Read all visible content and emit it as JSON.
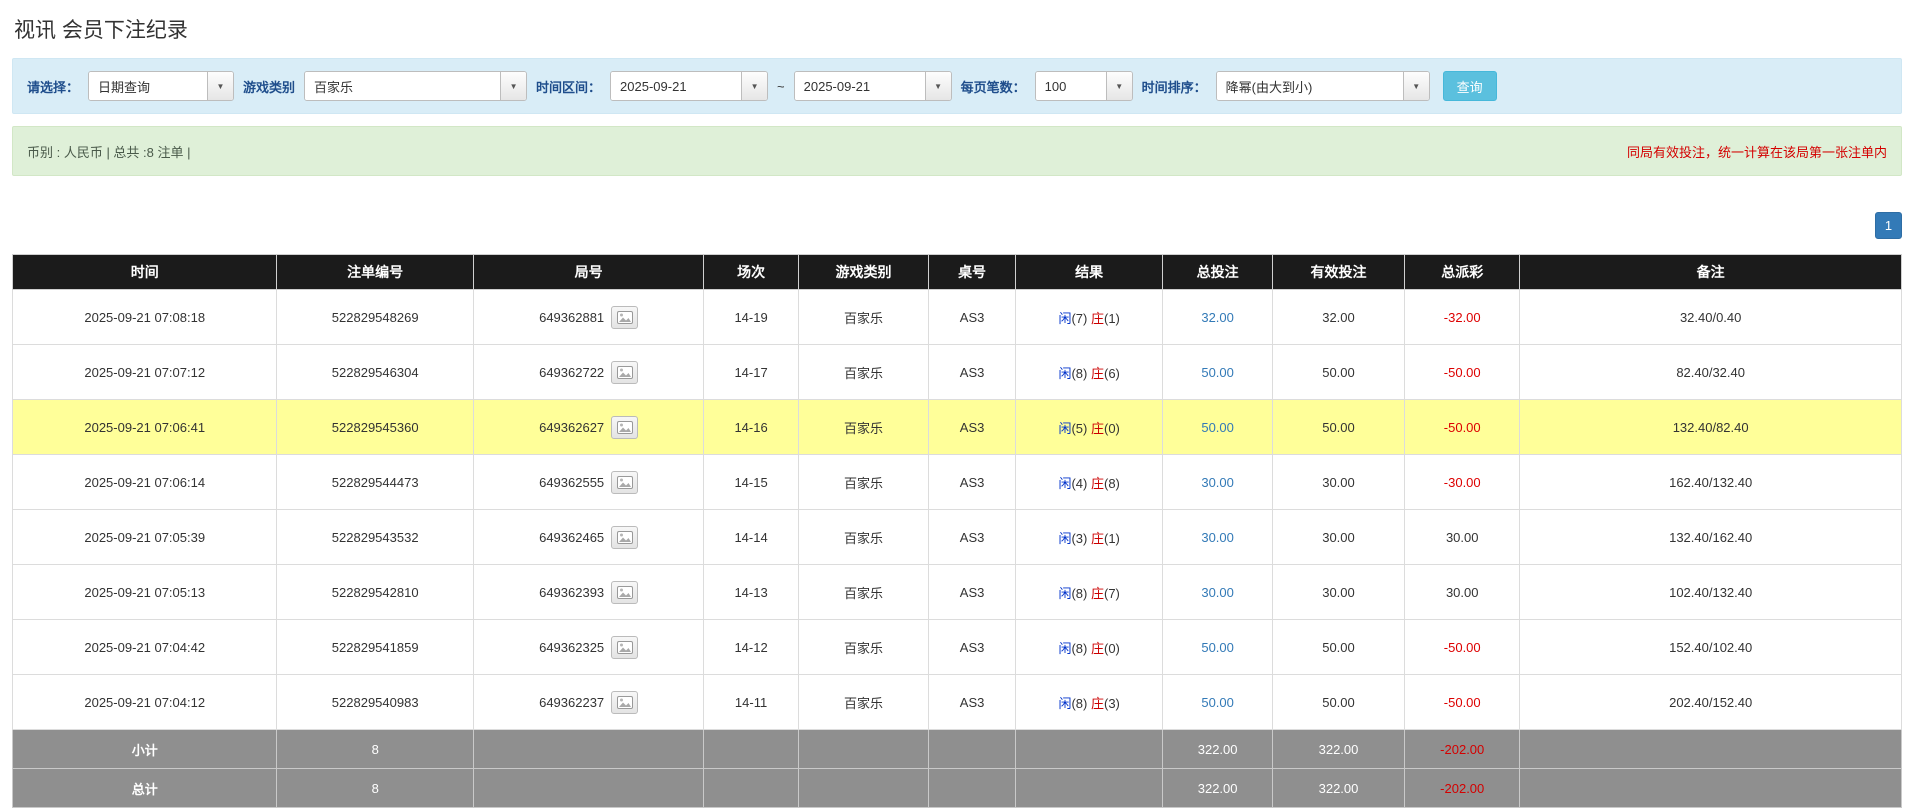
{
  "page_title": "视讯 会员下注纪录",
  "filter_bar": {
    "query_type": {
      "label": "请选择：",
      "value": "日期查询"
    },
    "game_type": {
      "label": "游戏类别",
      "value": "百家乐"
    },
    "time_range": {
      "label": "时间区间：",
      "from": "2025-09-21",
      "separator": "~",
      "to": "2025-09-21"
    },
    "page_size": {
      "label": "每页笔数：",
      "value": "100"
    },
    "sort": {
      "label": "时间排序：",
      "value": "降幂(由大到小)"
    },
    "search_button_label": "查询"
  },
  "summary_bar": {
    "left_text": "币别 : 人民币 | 总共 :8 注单 |",
    "right_notice": "同局有效投注，统一计算在该局第一张注单内"
  },
  "pagination": {
    "current_page": "1"
  },
  "table": {
    "headers": [
      "时间",
      "注单编号",
      "局号",
      "场次",
      "游戏类别",
      "桌号",
      "结果",
      "总投注",
      "有效投注",
      "总派彩",
      "备注"
    ],
    "rows": [
      {
        "time": "2025-09-21 07:08:18",
        "bet_id": "522829548269",
        "round_no": "649362881",
        "session": "14-19",
        "game_type": "百家乐",
        "table_no": "AS3",
        "result": {
          "player": "闲",
          "player_score": "(7)",
          "banker": "庄",
          "banker_score": "(1)"
        },
        "total_bet": "32.00",
        "valid_bet": "32.00",
        "payout": "-32.00",
        "remark": "32.40/0.40",
        "highlighted": false
      },
      {
        "time": "2025-09-21 07:07:12",
        "bet_id": "522829546304",
        "round_no": "649362722",
        "session": "14-17",
        "game_type": "百家乐",
        "table_no": "AS3",
        "result": {
          "player": "闲",
          "player_score": "(8)",
          "banker": "庄",
          "banker_score": "(6)"
        },
        "total_bet": "50.00",
        "valid_bet": "50.00",
        "payout": "-50.00",
        "remark": "82.40/32.40",
        "highlighted": false
      },
      {
        "time": "2025-09-21 07:06:41",
        "bet_id": "522829545360",
        "round_no": "649362627",
        "session": "14-16",
        "game_type": "百家乐",
        "table_no": "AS3",
        "result": {
          "player": "闲",
          "player_score": "(5)",
          "banker": "庄",
          "banker_score": "(0)"
        },
        "total_bet": "50.00",
        "valid_bet": "50.00",
        "payout": "-50.00",
        "remark": "132.40/82.40",
        "highlighted": true
      },
      {
        "time": "2025-09-21 07:06:14",
        "bet_id": "522829544473",
        "round_no": "649362555",
        "session": "14-15",
        "game_type": "百家乐",
        "table_no": "AS3",
        "result": {
          "player": "闲",
          "player_score": "(4)",
          "banker": "庄",
          "banker_score": "(8)"
        },
        "total_bet": "30.00",
        "valid_bet": "30.00",
        "payout": "-30.00",
        "remark": "162.40/132.40",
        "highlighted": false
      },
      {
        "time": "2025-09-21 07:05:39",
        "bet_id": "522829543532",
        "round_no": "649362465",
        "session": "14-14",
        "game_type": "百家乐",
        "table_no": "AS3",
        "result": {
          "player": "闲",
          "player_score": "(3)",
          "banker": "庄",
          "banker_score": "(1)"
        },
        "total_bet": "30.00",
        "valid_bet": "30.00",
        "payout": "30.00",
        "remark": "132.40/162.40",
        "highlighted": false
      },
      {
        "time": "2025-09-21 07:05:13",
        "bet_id": "522829542810",
        "round_no": "649362393",
        "session": "14-13",
        "game_type": "百家乐",
        "table_no": "AS3",
        "result": {
          "player": "闲",
          "player_score": "(8)",
          "banker": "庄",
          "banker_score": "(7)"
        },
        "total_bet": "30.00",
        "valid_bet": "30.00",
        "payout": "30.00",
        "remark": "102.40/132.40",
        "highlighted": false
      },
      {
        "time": "2025-09-21 07:04:42",
        "bet_id": "522829541859",
        "round_no": "649362325",
        "session": "14-12",
        "game_type": "百家乐",
        "table_no": "AS3",
        "result": {
          "player": "闲",
          "player_score": "(8)",
          "banker": "庄",
          "banker_score": "(0)"
        },
        "total_bet": "50.00",
        "valid_bet": "50.00",
        "payout": "-50.00",
        "remark": "152.40/102.40",
        "highlighted": false
      },
      {
        "time": "2025-09-21 07:04:12",
        "bet_id": "522829540983",
        "round_no": "649362237",
        "session": "14-11",
        "game_type": "百家乐",
        "table_no": "AS3",
        "result": {
          "player": "闲",
          "player_score": "(8)",
          "banker": "庄",
          "banker_score": "(3)"
        },
        "total_bet": "50.00",
        "valid_bet": "50.00",
        "payout": "-50.00",
        "remark": "202.40/152.40",
        "highlighted": false
      }
    ],
    "subtotal_row": {
      "label": "小计",
      "count": "8",
      "total_bet": "322.00",
      "valid_bet": "322.00",
      "payout": "-202.00"
    },
    "total_row": {
      "label": "总计",
      "count": "8",
      "total_bet": "322.00",
      "valid_bet": "322.00",
      "payout": "-202.00"
    }
  },
  "colors": {
    "label_blue": "#1f4e8c",
    "button_blue": "#5bc0de",
    "page_btn_blue": "#337ab7",
    "link_blue": "#337ab7",
    "player_blue": "#0033cc",
    "banker_red": "#cc0000",
    "negative_red": "#dd0000",
    "notice_red": "#d40000",
    "highlight_yellow": "#ffff99",
    "header_bg": "#1b1b1b",
    "footer_bg": "#8f8f8f",
    "filter_bg": "#d9edf7",
    "summary_bg": "#dff0d8"
  }
}
